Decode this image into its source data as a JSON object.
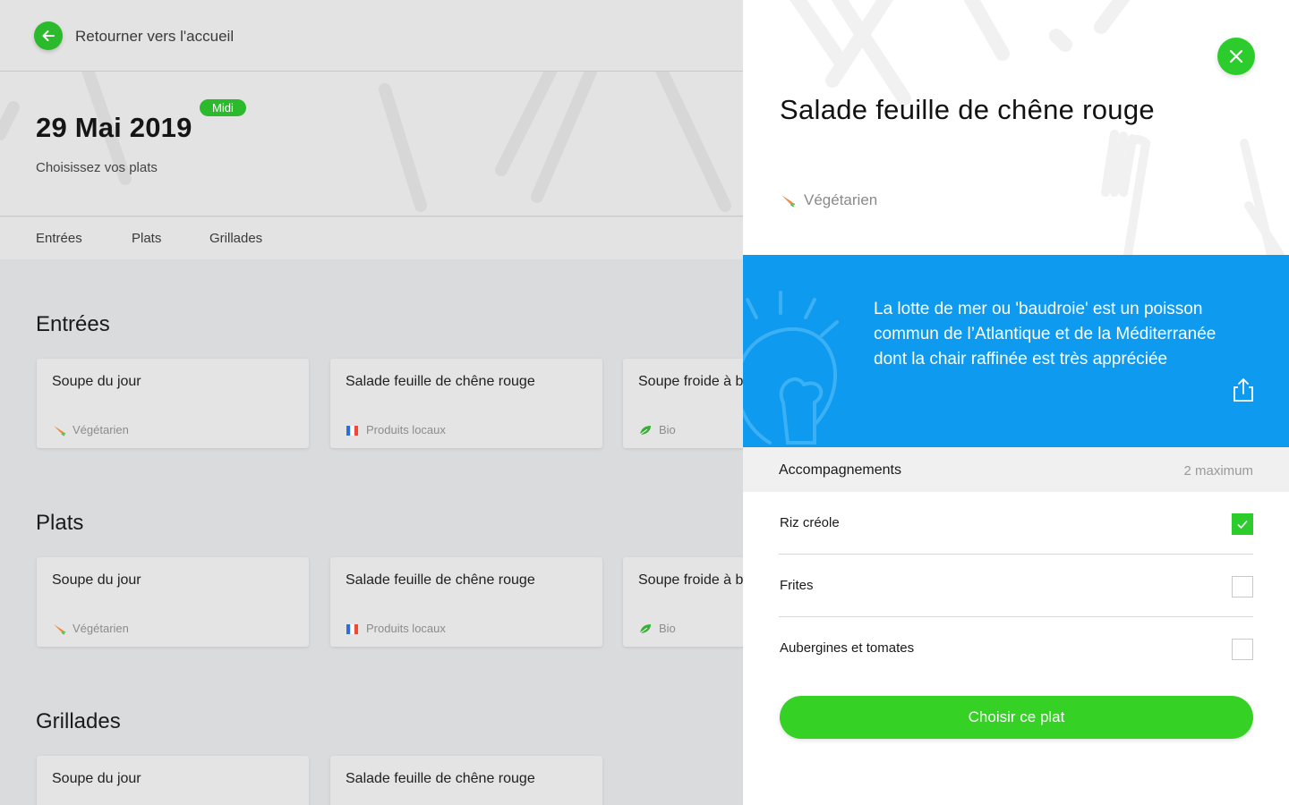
{
  "nav": {
    "back_label": "Retourner vers l'accueil"
  },
  "header": {
    "date": "29 Mai 2019",
    "badge": "Midi",
    "subtitle": "Choisissez vos plats"
  },
  "tabs": [
    {
      "label": "Entrées"
    },
    {
      "label": "Plats"
    },
    {
      "label": "Grillades"
    }
  ],
  "sections": [
    {
      "title": "Entrées",
      "cards": [
        {
          "name": "Soupe du jour",
          "tag": "Végétarien",
          "tag_icon": "carrot-icon"
        },
        {
          "name": "Salade feuille de chêne rouge",
          "tag": "Produits locaux",
          "tag_icon": "local-products-icon"
        },
        {
          "name": "Soupe froide à betterave",
          "tag": "Bio",
          "tag_icon": "leaf-icon"
        }
      ]
    },
    {
      "title": "Plats",
      "cards": [
        {
          "name": "Soupe du jour",
          "tag": "Végétarien",
          "tag_icon": "carrot-icon"
        },
        {
          "name": "Salade feuille de chêne rouge",
          "tag": "Produits locaux",
          "tag_icon": "local-products-icon"
        },
        {
          "name": "Soupe froide à betterave",
          "tag": "Bio",
          "tag_icon": "leaf-icon"
        }
      ]
    },
    {
      "title": "Grillades",
      "cards": [
        {
          "name": "Soupe du jour"
        },
        {
          "name": "Salade feuille de chêne rouge"
        }
      ]
    }
  ],
  "panel": {
    "title": "Salade feuille de chêne rouge",
    "tag": "Végétarien",
    "tag_icon": "carrot-icon",
    "info": "La lotte de mer ou 'baudroie' est un poisson commun de l’Atlantique et de la Méditerranée dont la chair raffinée est très appréciée",
    "accompaniments": {
      "title": "Accompagnements",
      "max": "2 maximum",
      "options": [
        {
          "label": "Riz créole",
          "checked": true
        },
        {
          "label": "Frites",
          "checked": false
        },
        {
          "label": "Aubergines et tomates",
          "checked": false
        }
      ]
    },
    "cta": "Choisir ce plat"
  },
  "colors": {
    "accent_green": "#2bcc2b",
    "info_blue": "#0d9aef",
    "overlay_grey": "#dadbdc"
  }
}
